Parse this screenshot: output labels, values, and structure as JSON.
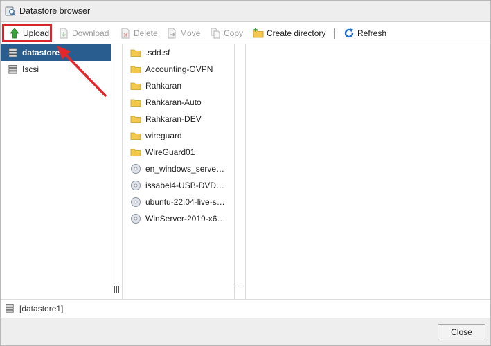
{
  "window": {
    "title": "Datastore browser"
  },
  "toolbar": {
    "upload": "Upload",
    "download": "Download",
    "delete": "Delete",
    "move": "Move",
    "copy": "Copy",
    "create_directory": "Create directory",
    "refresh": "Refresh"
  },
  "datastores": [
    {
      "label": "datastore1",
      "selected": true
    },
    {
      "label": "Iscsi",
      "selected": false
    }
  ],
  "files": [
    {
      "name": ".sdd.sf",
      "type": "folder"
    },
    {
      "name": "Accounting-OVPN",
      "type": "folder"
    },
    {
      "name": "Rahkaran",
      "type": "folder"
    },
    {
      "name": "Rahkaran-Auto",
      "type": "folder"
    },
    {
      "name": "Rahkaran-DEV",
      "type": "folder"
    },
    {
      "name": "wireguard",
      "type": "folder"
    },
    {
      "name": "WireGuard01",
      "type": "folder"
    },
    {
      "name": "en_windows_serve…",
      "type": "iso"
    },
    {
      "name": "issabel4-USB-DVD…",
      "type": "iso"
    },
    {
      "name": "ubuntu-22.04-live-s…",
      "type": "iso"
    },
    {
      "name": "WinServer-2019-x6…",
      "type": "iso"
    }
  ],
  "status": {
    "path": "[datastore1]"
  },
  "footer": {
    "close": "Close"
  },
  "colors": {
    "selection": "#2a5d8f",
    "highlight": "#d9252b",
    "folder": "#f2c94c"
  }
}
